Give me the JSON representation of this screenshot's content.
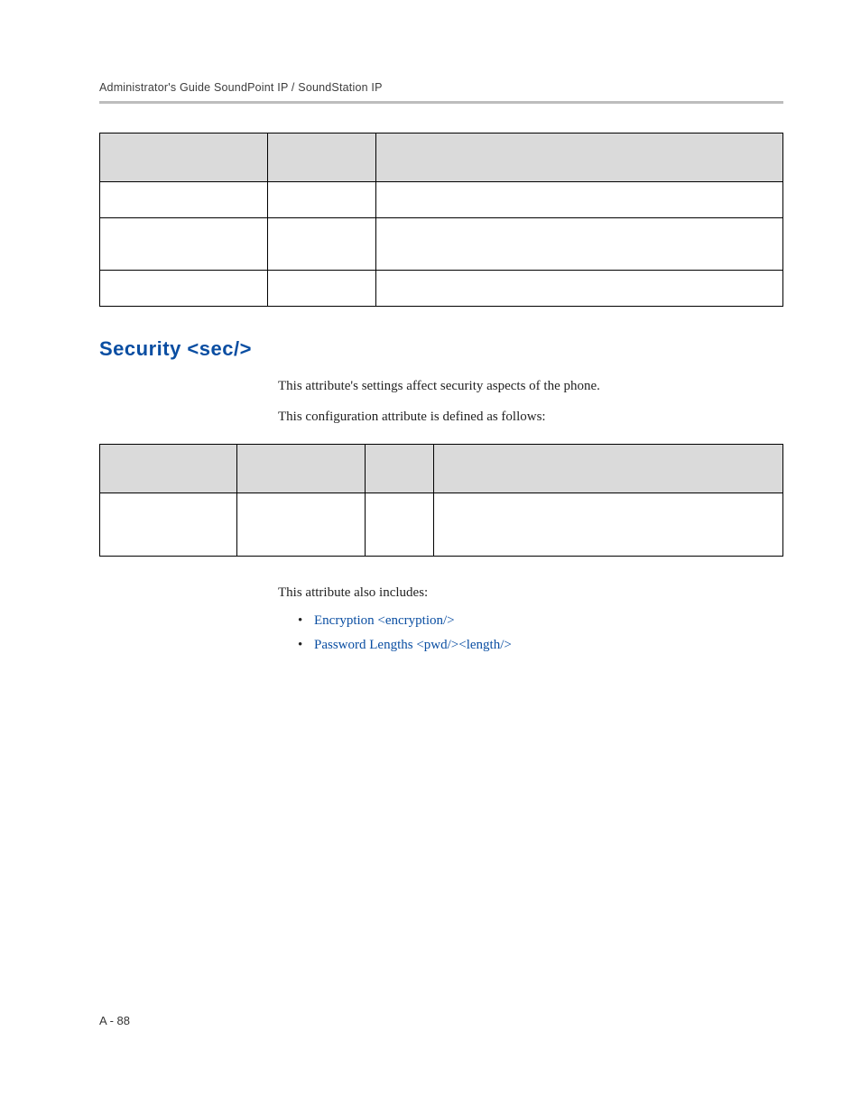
{
  "header": {
    "running": "Administrator's Guide SoundPoint IP / SoundStation IP"
  },
  "heading": "Security <sec/>",
  "paragraphs": {
    "p1": "This attribute's settings affect security aspects of the phone.",
    "p2": "This configuration attribute is defined as follows:",
    "p3": "This attribute also includes:"
  },
  "links": {
    "l1": "Encryption <encryption/>",
    "l2": "Password Lengths <pwd/><length/>"
  },
  "footer": {
    "page": "A - 88"
  }
}
